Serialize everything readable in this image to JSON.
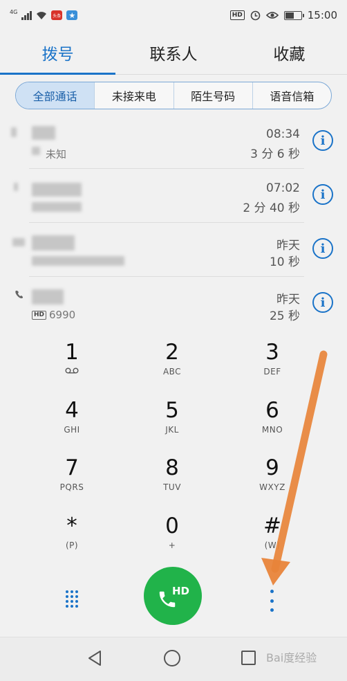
{
  "status_bar": {
    "network": "4G",
    "time": "15:00",
    "hd_label": "HD",
    "app_badge_text": "头条",
    "battery_level": 0.55
  },
  "tabs": [
    {
      "label": "拨号",
      "active": true
    },
    {
      "label": "联系人",
      "active": false
    },
    {
      "label": "收藏",
      "active": false
    }
  ],
  "filters": [
    {
      "label": "全部通话",
      "active": true
    },
    {
      "label": "未接来电",
      "active": false
    },
    {
      "label": "陌生号码",
      "active": false
    },
    {
      "label": "语音信箱",
      "active": false
    }
  ],
  "call_log": [
    {
      "time": "08:34",
      "duration": "3 分 6 秒",
      "subtitle": "未知",
      "has_hd": false
    },
    {
      "time": "07:02",
      "duration": "2 分 40 秒",
      "subtitle": "",
      "has_hd": false
    },
    {
      "time": "昨天",
      "duration": "10 秒",
      "subtitle": "",
      "has_hd": false
    },
    {
      "time": "昨天",
      "duration": "25 秒",
      "subtitle": "6990",
      "has_hd": true
    }
  ],
  "info_glyph": "i",
  "dialpad": [
    {
      "digit": "1",
      "letters": ""
    },
    {
      "digit": "2",
      "letters": "ABC"
    },
    {
      "digit": "3",
      "letters": "DEF"
    },
    {
      "digit": "4",
      "letters": "GHI"
    },
    {
      "digit": "5",
      "letters": "JKL"
    },
    {
      "digit": "6",
      "letters": "MNO"
    },
    {
      "digit": "7",
      "letters": "PQRS"
    },
    {
      "digit": "8",
      "letters": "TUV"
    },
    {
      "digit": "9",
      "letters": "WXYZ"
    },
    {
      "digit": "*",
      "letters": "(P)"
    },
    {
      "digit": "0",
      "letters": "+"
    },
    {
      "digit": "#",
      "letters": "(W)"
    }
  ],
  "call_button": {
    "label": "HD",
    "color": "#21b34a"
  },
  "accent_color": "#1a73c8",
  "annotation_arrow_color": "#e8843a",
  "watermark": "Bai度经验",
  "icons": {
    "voicemail": "voicemail-icon",
    "dialpad_toggle": "dialpad-icon",
    "phone": "phone-icon",
    "more": "more-vertical-icon",
    "back": "back-icon",
    "home": "home-icon",
    "recents": "recents-icon"
  }
}
